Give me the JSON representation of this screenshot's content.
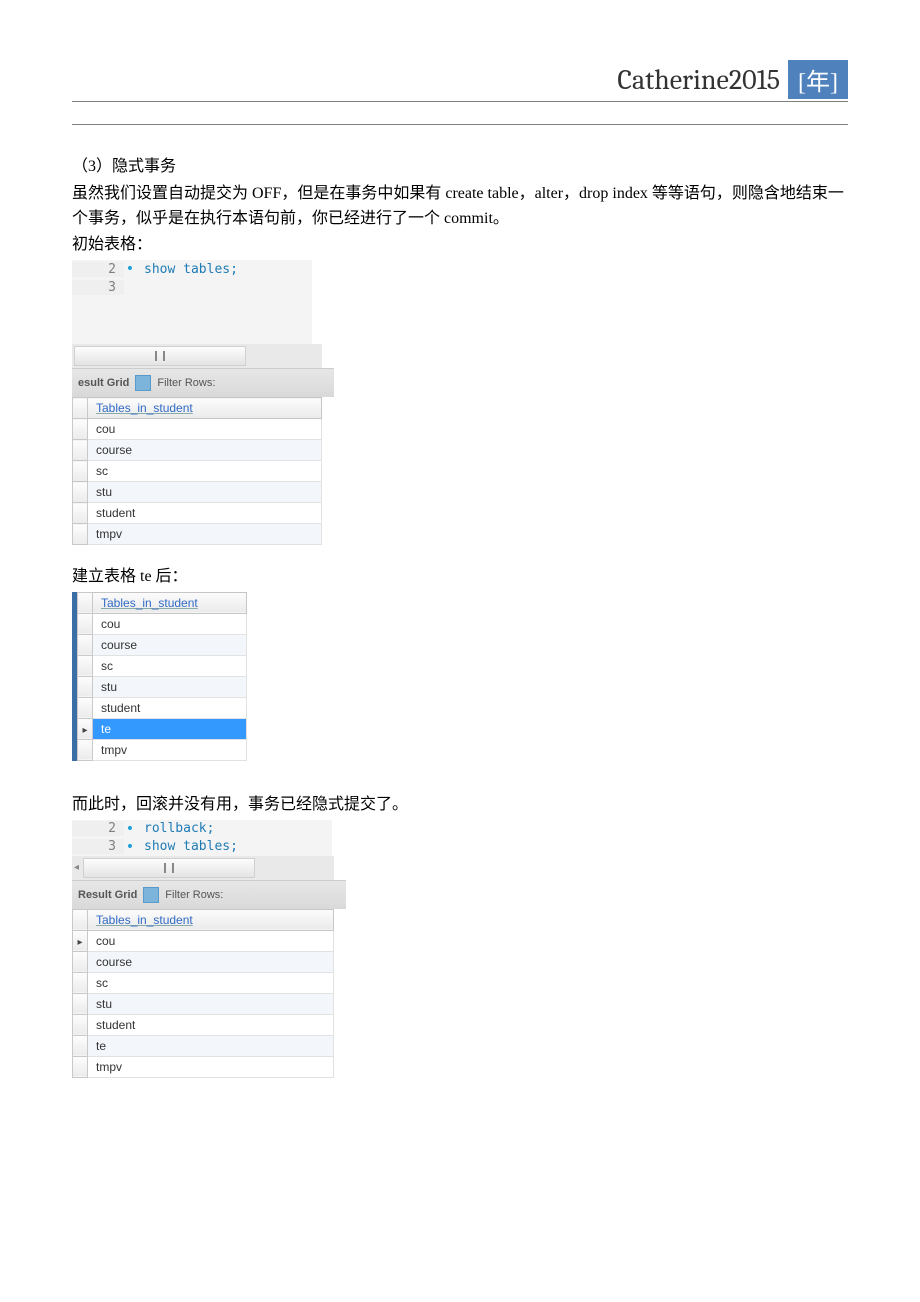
{
  "header": {
    "title": "Catherine2015",
    "year_label": "[年]"
  },
  "body": {
    "heading": "（3）隐式事务",
    "p1": "虽然我们设置自动提交为 OFF，但是在事务中如果有 create  table，alter，drop  index 等等语句，则隐含地结束一个事务，似乎是在执行本语句前，你已经进行了一个 commit。",
    "label_initial": "初始表格：",
    "label_after_create": "建立表格 te 后：",
    "label_after_rollback": "而此时，回滚并没有用，事务已经隐式提交了。"
  },
  "sql1": {
    "lines": [
      {
        "num": "2",
        "dot": true,
        "code": "show tables;"
      },
      {
        "num": "3",
        "dot": false,
        "code": ""
      }
    ]
  },
  "sql3": {
    "lines": [
      {
        "num": "2",
        "dot": true,
        "code": "rollback;"
      },
      {
        "num": "3",
        "dot": true,
        "code": "show tables;"
      }
    ]
  },
  "toolbar": {
    "label_result_grid_trunc": "esult Grid",
    "label_result_grid": "Result Grid",
    "filter_rows": "Filter Rows:"
  },
  "grid_header": "Tables_in_student",
  "grid1_rows": [
    "cou",
    "course",
    "sc",
    "stu",
    "student",
    "tmpv"
  ],
  "grid2_rows": [
    "cou",
    "course",
    "sc",
    "stu",
    "student",
    "te",
    "tmpv"
  ],
  "grid2_selected_index": 5,
  "grid3_rows": [
    "cou",
    "course",
    "sc",
    "stu",
    "student",
    "te",
    "tmpv"
  ],
  "grid3_pointer_index": 0
}
